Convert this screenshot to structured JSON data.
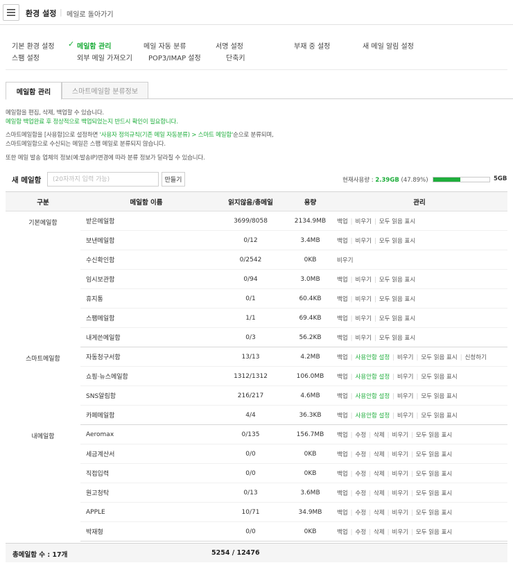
{
  "header": {
    "title": "환경 설정",
    "separator": "|",
    "back_link": "메일로 돌아가기"
  },
  "nav": {
    "items": [
      {
        "label": "기본 환경 설정",
        "active": false
      },
      {
        "label": "메일함 관리",
        "active": true
      },
      {
        "label": "메일 자동 분류",
        "active": false
      },
      {
        "label": "서명 설정",
        "active": false
      },
      {
        "label": "부재 중 설정",
        "active": false
      },
      {
        "label": "새 메일 알림 설정",
        "active": false
      },
      {
        "label": "스팸 설정",
        "active": false
      },
      {
        "label": "외부 메일 가져오기",
        "active": false
      },
      {
        "label": "POP3/IMAP 설정",
        "active": false
      },
      {
        "label": "단축키",
        "active": false
      }
    ]
  },
  "tabs": [
    {
      "label": "메일함 관리",
      "active": true
    },
    {
      "label": "스마트메일함 분류정보",
      "active": false
    }
  ],
  "description": {
    "line1": "메일함을 편집, 삭제, 백업할 수 있습니다.",
    "line2": "메일함 백업완료 후 정상적으로 백업되었는지 반드시 확인이 필요합니다.",
    "line3_a": "스마트메일함을 [사용함]으로 설정하면 ",
    "line3_b": "'사용자 정의규칙(기존 메일 자동분류) > 스마트 메일함'",
    "line3_c": "순으로 분류되며,",
    "line4": "스마트메일함으로 수신되는 메일은 스팸 메일로 분류되지 않습니다.",
    "line5": "또한 메일 발송 업체의 정보(예:발송IP)변경에 따라 분류 정보가 달라질 수 있습니다."
  },
  "new_mailbox": {
    "label": "새 메일함",
    "placeholder": "(20자까지 입력 가능)",
    "create_button": "만들기"
  },
  "usage": {
    "label": "현재사용량 : ",
    "used": "2.39GB",
    "percent_text": "(47.89%)",
    "percent": 47.89,
    "max": "5GB",
    "accent_color": "#1fae3c"
  },
  "table": {
    "headers": [
      "구분",
      "메일함 이름",
      "읽지않음/총메일",
      "용량",
      "관리"
    ],
    "groups": [
      {
        "category": "기본메일함",
        "rows": [
          {
            "name": "받은메일함",
            "count": "3699/8058",
            "size": "2134.9MB",
            "actions": [
              {
                "label": "백업",
                "green": false
              },
              {
                "label": "비우기",
                "green": false
              },
              {
                "label": "모두 읽음 표시",
                "green": false
              }
            ]
          },
          {
            "name": "보낸메일함",
            "count": "0/12",
            "size": "3.4MB",
            "actions": [
              {
                "label": "백업",
                "green": false
              },
              {
                "label": "비우기",
                "green": false
              },
              {
                "label": "모두 읽음 표시",
                "green": false
              }
            ]
          },
          {
            "name": "수신확인함",
            "count": "0/2542",
            "size": "0KB",
            "actions": [
              {
                "label": "비우기",
                "green": false
              }
            ]
          },
          {
            "name": "임시보관함",
            "count": "0/94",
            "size": "3.0MB",
            "actions": [
              {
                "label": "백업",
                "green": false
              },
              {
                "label": "비우기",
                "green": false
              },
              {
                "label": "모두 읽음 표시",
                "green": false
              }
            ]
          },
          {
            "name": "휴지통",
            "count": "0/1",
            "size": "60.4KB",
            "actions": [
              {
                "label": "백업",
                "green": false
              },
              {
                "label": "비우기",
                "green": false
              },
              {
                "label": "모두 읽음 표시",
                "green": false
              }
            ]
          },
          {
            "name": "스팸메일함",
            "count": "1/1",
            "size": "69.4KB",
            "actions": [
              {
                "label": "백업",
                "green": false
              },
              {
                "label": "비우기",
                "green": false
              },
              {
                "label": "모두 읽음 표시",
                "green": false
              }
            ]
          },
          {
            "name": "내게쓴메일함",
            "count": "0/3",
            "size": "56.2KB",
            "actions": [
              {
                "label": "백업",
                "green": false
              },
              {
                "label": "비우기",
                "green": false
              },
              {
                "label": "모두 읽음 표시",
                "green": false
              }
            ]
          }
        ]
      },
      {
        "category": "스마트메일함",
        "rows": [
          {
            "name": "자동청구서함",
            "count": "13/13",
            "size": "4.2MB",
            "actions": [
              {
                "label": "백업",
                "green": false
              },
              {
                "label": "사용안함 설정",
                "green": true
              },
              {
                "label": "비우기",
                "green": false
              },
              {
                "label": "모두 읽음 표시",
                "green": false
              },
              {
                "label": "신청하기",
                "green": false
              }
            ]
          },
          {
            "name": "쇼핑·뉴스메일함",
            "count": "1312/1312",
            "size": "106.0MB",
            "actions": [
              {
                "label": "백업",
                "green": false
              },
              {
                "label": "사용안함 설정",
                "green": true
              },
              {
                "label": "비우기",
                "green": false
              },
              {
                "label": "모두 읽음 표시",
                "green": false
              }
            ]
          },
          {
            "name": "SNS알림함",
            "count": "216/217",
            "size": "4.6MB",
            "actions": [
              {
                "label": "백업",
                "green": false
              },
              {
                "label": "사용안함 설정",
                "green": true
              },
              {
                "label": "비우기",
                "green": false
              },
              {
                "label": "모두 읽음 표시",
                "green": false
              }
            ]
          },
          {
            "name": "카페메일함",
            "count": "4/4",
            "size": "36.3KB",
            "actions": [
              {
                "label": "백업",
                "green": false
              },
              {
                "label": "사용안함 설정",
                "green": true
              },
              {
                "label": "비우기",
                "green": false
              },
              {
                "label": "모두 읽음 표시",
                "green": false
              }
            ]
          }
        ]
      },
      {
        "category": "내메일함",
        "rows": [
          {
            "name": "Aeromax",
            "count": "0/135",
            "size": "156.7MB",
            "actions": [
              {
                "label": "백업",
                "green": false
              },
              {
                "label": "수정",
                "green": false
              },
              {
                "label": "삭제",
                "green": false
              },
              {
                "label": "비우기",
                "green": false
              },
              {
                "label": "모두 읽음 표시",
                "green": false
              }
            ]
          },
          {
            "name": "세금계산서",
            "count": "0/0",
            "size": "0KB",
            "actions": [
              {
                "label": "백업",
                "green": false
              },
              {
                "label": "수정",
                "green": false
              },
              {
                "label": "삭제",
                "green": false
              },
              {
                "label": "비우기",
                "green": false
              },
              {
                "label": "모두 읽음 표시",
                "green": false
              }
            ]
          },
          {
            "name": "직접입력",
            "count": "0/0",
            "size": "0KB",
            "actions": [
              {
                "label": "백업",
                "green": false
              },
              {
                "label": "수정",
                "green": false
              },
              {
                "label": "삭제",
                "green": false
              },
              {
                "label": "비우기",
                "green": false
              },
              {
                "label": "모두 읽음 표시",
                "green": false
              }
            ]
          },
          {
            "name": "원고청탁",
            "count": "0/13",
            "size": "3.6MB",
            "actions": [
              {
                "label": "백업",
                "green": false
              },
              {
                "label": "수정",
                "green": false
              },
              {
                "label": "삭제",
                "green": false
              },
              {
                "label": "비우기",
                "green": false
              },
              {
                "label": "모두 읽음 표시",
                "green": false
              }
            ]
          },
          {
            "name": "APPLE",
            "count": "10/71",
            "size": "34.9MB",
            "actions": [
              {
                "label": "백업",
                "green": false
              },
              {
                "label": "수정",
                "green": false
              },
              {
                "label": "삭제",
                "green": false
              },
              {
                "label": "비우기",
                "green": false
              },
              {
                "label": "모두 읽음 표시",
                "green": false
              }
            ]
          },
          {
            "name": "박재형",
            "count": "0/0",
            "size": "0KB",
            "actions": [
              {
                "label": "백업",
                "green": false
              },
              {
                "label": "수정",
                "green": false
              },
              {
                "label": "삭제",
                "green": false
              },
              {
                "label": "비우기",
                "green": false
              },
              {
                "label": "모두 읽음 표시",
                "green": false
              }
            ]
          }
        ]
      }
    ]
  },
  "footer": {
    "label": "총메일함 수 : 17개",
    "total": "5254 / 12476"
  },
  "icons": {
    "menu": "hamburger-menu-icon",
    "check": "checkmark-icon"
  }
}
